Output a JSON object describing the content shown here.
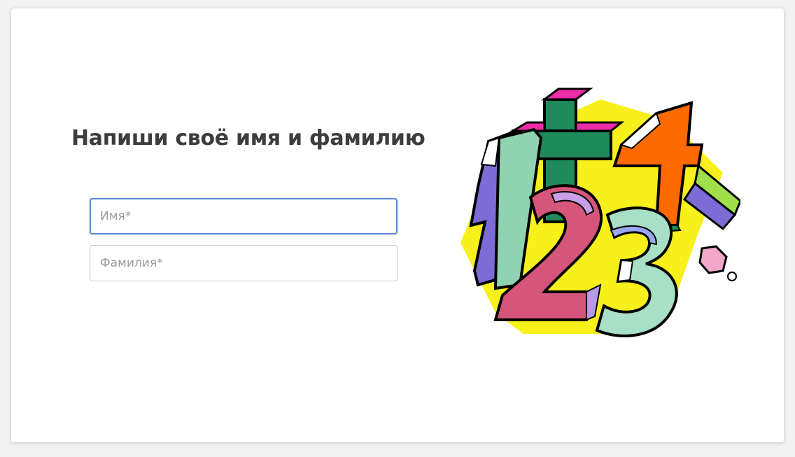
{
  "form": {
    "heading": "Напиши своё имя и фамилию",
    "first_name": {
      "value": "",
      "placeholder": "Имя*"
    },
    "last_name": {
      "value": "",
      "placeholder": "Фамилия*"
    }
  },
  "illustration": {
    "icon": "numbers-1-2-3-4-plus-clipart",
    "colors": {
      "burst": "#f7f01a",
      "one": "#8fd3b0",
      "two": "#d6557a",
      "three": "#a7e0c6",
      "four": "#ff6a00",
      "plus": "#1f8a5a",
      "accent": "#ee2ca8",
      "side": "#7d6bd6"
    }
  }
}
